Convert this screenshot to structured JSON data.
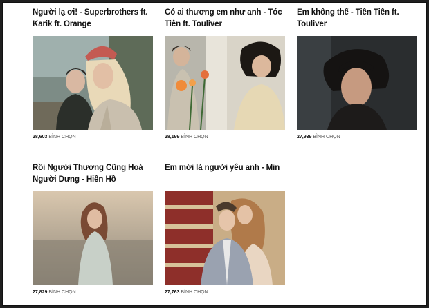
{
  "vote_label": "BÌNH CHỌN",
  "cards": [
    {
      "title": "Người lạ ơi! - Superbrothers ft. Karik ft. Orange",
      "votes": "28,603"
    },
    {
      "title": "Có ai thương em như anh - Tóc Tiên ft. Touliver",
      "votes": "28,199"
    },
    {
      "title": "Em không thể - Tiên Tiên ft. Touliver",
      "votes": "27,939"
    },
    {
      "title": "Rồi Người Thương Cũng Hoá Người Dưng - Hiền Hồ",
      "votes": "27,829"
    },
    {
      "title": "Em mới là người yêu anh - Min",
      "votes": "27,763"
    }
  ]
}
